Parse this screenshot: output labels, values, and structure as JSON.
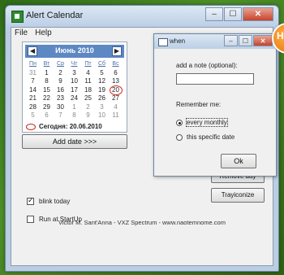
{
  "main_window": {
    "title": "Alert Calendar",
    "menu": [
      "File",
      "Help"
    ]
  },
  "calendar": {
    "month_label": "Июнь 2010",
    "day_headers": [
      "Пн",
      "Вт",
      "Ср",
      "Чт",
      "Пт",
      "Сб",
      "Вс"
    ],
    "weeks": [
      [
        "31",
        "1",
        "2",
        "3",
        "4",
        "5",
        "6"
      ],
      [
        "7",
        "8",
        "9",
        "10",
        "11",
        "12",
        "13"
      ],
      [
        "14",
        "15",
        "16",
        "17",
        "18",
        "19",
        "20"
      ],
      [
        "21",
        "22",
        "23",
        "24",
        "25",
        "26",
        "27"
      ],
      [
        "28",
        "29",
        "30",
        "1",
        "2",
        "3",
        "4"
      ],
      [
        "5",
        "6",
        "7",
        "8",
        "9",
        "10",
        "11"
      ]
    ],
    "today_label": "Сегодня: 20.06.2010"
  },
  "buttons": {
    "add_date": "Add date >>>",
    "remove_day": "Remove day",
    "trayiconize": "Trayiconize"
  },
  "options": {
    "blink_today": "blink today",
    "run_at_startup": "Run at StartUp"
  },
  "footer": "Victor M. Sant'Anna - VXZ Spectrum - www.naotemnome.com",
  "dialog": {
    "title": "when",
    "note_label": "add a note (optional):",
    "note_value": "",
    "remember_label": "Remember me:",
    "radio_every_monthly": "every monthly",
    "radio_specific_date": "this specific date",
    "ok_label": "Ok"
  },
  "badge_text": "H"
}
